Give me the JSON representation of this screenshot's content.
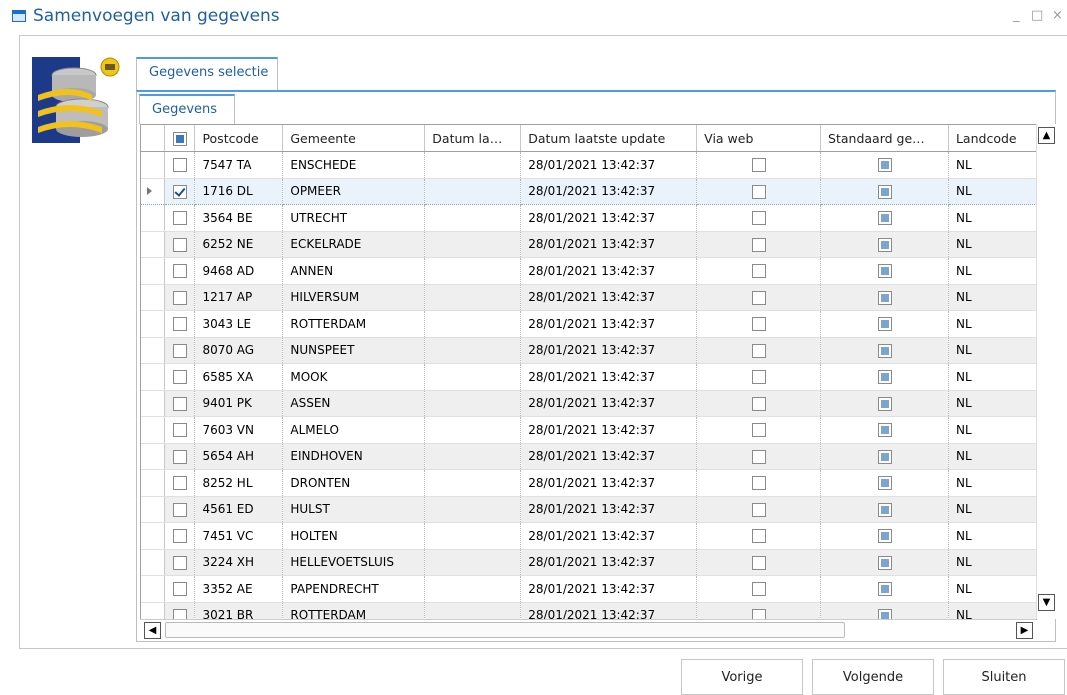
{
  "window": {
    "title": "Samenvoegen van gegevens",
    "minimize": "_",
    "maximize": "□",
    "close": "×"
  },
  "tabs": {
    "outer": "Gegevens selectie",
    "inner": "Gegevens"
  },
  "columns": [
    "",
    "Postcode",
    "Gemeente",
    "Datum la…",
    "Datum laatste update",
    "Via web",
    "Standaard ge…",
    "Landcode"
  ],
  "rows": [
    {
      "checked": false,
      "postcode": "7547 TA",
      "gemeente": "ENSCHEDE",
      "datum": "",
      "update": "28/01/2021 13:42:37",
      "via_web": false,
      "standaard": true,
      "landcode": "NL"
    },
    {
      "checked": true,
      "postcode": "1716 DL",
      "gemeente": "OPMEER",
      "datum": "",
      "update": "28/01/2021 13:42:37",
      "via_web": false,
      "standaard": true,
      "landcode": "NL",
      "selected": true
    },
    {
      "checked": false,
      "postcode": "3564 BE",
      "gemeente": "UTRECHT",
      "datum": "",
      "update": "28/01/2021 13:42:37",
      "via_web": false,
      "standaard": true,
      "landcode": "NL"
    },
    {
      "checked": false,
      "postcode": "6252 NE",
      "gemeente": "ECKELRADE",
      "datum": "",
      "update": "28/01/2021 13:42:37",
      "via_web": false,
      "standaard": true,
      "landcode": "NL"
    },
    {
      "checked": false,
      "postcode": "9468 AD",
      "gemeente": "ANNEN",
      "datum": "",
      "update": "28/01/2021 13:42:37",
      "via_web": false,
      "standaard": true,
      "landcode": "NL"
    },
    {
      "checked": false,
      "postcode": "1217 AP",
      "gemeente": "HILVERSUM",
      "datum": "",
      "update": "28/01/2021 13:42:37",
      "via_web": false,
      "standaard": true,
      "landcode": "NL"
    },
    {
      "checked": false,
      "postcode": "3043 LE",
      "gemeente": "ROTTERDAM",
      "datum": "",
      "update": "28/01/2021 13:42:37",
      "via_web": false,
      "standaard": true,
      "landcode": "NL"
    },
    {
      "checked": false,
      "postcode": "8070 AG",
      "gemeente": "NUNSPEET",
      "datum": "",
      "update": "28/01/2021 13:42:37",
      "via_web": false,
      "standaard": true,
      "landcode": "NL"
    },
    {
      "checked": false,
      "postcode": "6585 XA",
      "gemeente": "MOOK",
      "datum": "",
      "update": "28/01/2021 13:42:37",
      "via_web": false,
      "standaard": true,
      "landcode": "NL"
    },
    {
      "checked": false,
      "postcode": "9401 PK",
      "gemeente": "ASSEN",
      "datum": "",
      "update": "28/01/2021 13:42:37",
      "via_web": false,
      "standaard": true,
      "landcode": "NL"
    },
    {
      "checked": false,
      "postcode": "7603 VN",
      "gemeente": "ALMELO",
      "datum": "",
      "update": "28/01/2021 13:42:37",
      "via_web": false,
      "standaard": true,
      "landcode": "NL"
    },
    {
      "checked": false,
      "postcode": "5654 AH",
      "gemeente": "EINDHOVEN",
      "datum": "",
      "update": "28/01/2021 13:42:37",
      "via_web": false,
      "standaard": true,
      "landcode": "NL"
    },
    {
      "checked": false,
      "postcode": "8252 HL",
      "gemeente": "DRONTEN",
      "datum": "",
      "update": "28/01/2021 13:42:37",
      "via_web": false,
      "standaard": true,
      "landcode": "NL"
    },
    {
      "checked": false,
      "postcode": "4561 ED",
      "gemeente": "HULST",
      "datum": "",
      "update": "28/01/2021 13:42:37",
      "via_web": false,
      "standaard": true,
      "landcode": "NL"
    },
    {
      "checked": false,
      "postcode": "7451 VC",
      "gemeente": "HOLTEN",
      "datum": "",
      "update": "28/01/2021 13:42:37",
      "via_web": false,
      "standaard": true,
      "landcode": "NL"
    },
    {
      "checked": false,
      "postcode": "3224 XH",
      "gemeente": "HELLEVOETSLUIS",
      "datum": "",
      "update": "28/01/2021 13:42:37",
      "via_web": false,
      "standaard": true,
      "landcode": "NL"
    },
    {
      "checked": false,
      "postcode": "3352 AE",
      "gemeente": "PAPENDRECHT",
      "datum": "",
      "update": "28/01/2021 13:42:37",
      "via_web": false,
      "standaard": true,
      "landcode": "NL"
    },
    {
      "checked": false,
      "postcode": "3021 BR",
      "gemeente": "ROTTERDAM",
      "datum": "",
      "update": "28/01/2021 13:42:37",
      "via_web": false,
      "standaard": true,
      "landcode": "NL"
    }
  ],
  "buttons": {
    "prev": "Vorige",
    "next": "Volgende",
    "close": "Sluiten"
  },
  "colors": {
    "accent": "#1f5fa6",
    "tab_border": "#4d9be0",
    "checkbox_fill": "#7ba4cf"
  }
}
